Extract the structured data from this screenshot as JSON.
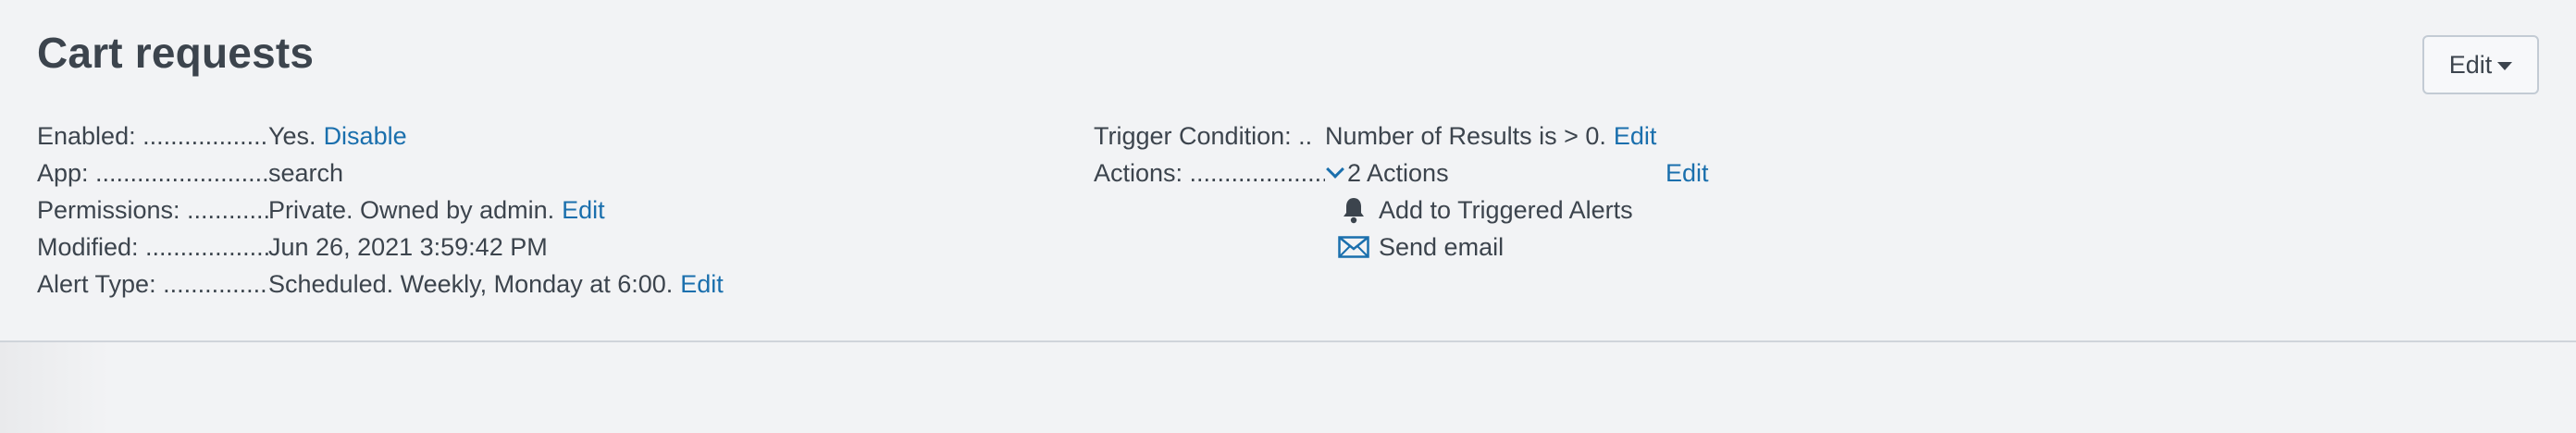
{
  "header": {
    "title": "Cart requests",
    "edit_button": "Edit"
  },
  "left": {
    "enabled": {
      "label": "Enabled: ....................",
      "value": "Yes.",
      "link": "Disable"
    },
    "app": {
      "label": "App: ..........................",
      "value": "search"
    },
    "permissions": {
      "label": "Permissions: ............",
      "value": "Private. Owned by admin.",
      "link": "Edit"
    },
    "modified": {
      "label": "Modified: ..................",
      "value": "Jun 26, 2021 3:59:42 PM"
    },
    "alert_type": {
      "label": "Alert Type: ................",
      "value": "Scheduled. Weekly, Monday at 6:00.",
      "link": "Edit"
    }
  },
  "right": {
    "trigger": {
      "label": "Trigger Condition: ..",
      "value": "Number of Results is > 0.",
      "link": "Edit"
    },
    "actions": {
      "label": "Actions: ....................",
      "summary": "2 Actions",
      "link": "Edit",
      "items": [
        {
          "icon": "bell-icon",
          "label": "Add to Triggered Alerts"
        },
        {
          "icon": "envelope-icon",
          "label": "Send email"
        }
      ]
    }
  },
  "colors": {
    "link": "#1a6fad",
    "text": "#3c444d",
    "background": "#f2f3f5"
  }
}
